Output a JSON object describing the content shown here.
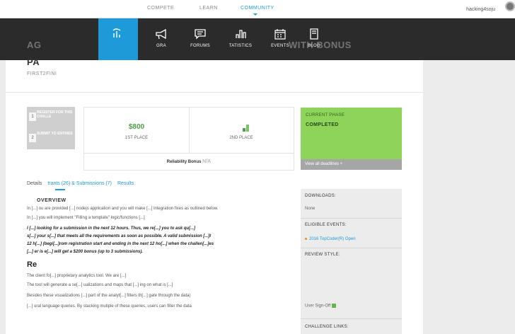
{
  "top_nav": {
    "tabs": [
      "COMPETE",
      "LEARN",
      "COMMUNITY"
    ],
    "active": "COMMUNITY",
    "username": "hacking4soju"
  },
  "sub_nav": {
    "items": [
      "",
      "GRA",
      "FORUMS",
      "TATISTICS",
      "EVENTS",
      "BLOG"
    ]
  },
  "challenge": {
    "title_top": "AG",
    "title_right": "WITH BONUS",
    "title_line2": "PA",
    "track": "FIRST2FINI"
  },
  "steps": [
    {
      "num": "1",
      "text": "REGISTER FOR THIS CHALLE"
    },
    {
      "num": "2",
      "text": "SUBMIT YO ENTRIES"
    }
  ],
  "prizes": {
    "first_amount": "$800",
    "first_label": "1ST PLACE",
    "second_label": "2ND PLACE",
    "reliability_label": "Reliability Bonus",
    "reliability_value": "N/A"
  },
  "phase": {
    "heading": "CURRENT PHASE",
    "value": "COMPLETED",
    "footer": "View all deadlines +"
  },
  "tabs": {
    "details": "Details",
    "registrants": "trants (26) & Submissions (7)",
    "results": "Results"
  },
  "body": {
    "section": "OVERVIEW",
    "p1": "In [...] ou are provided [...] nodejs application and you will make [...] integration fixes as outlined below.",
    "p2": "In [...] you will implement \"Filling a template\" logic/functions [...]",
    "italic1": "I [...] looking for a submission in the next 12 hours. Thus, we re[...] you to ask qu[...]",
    "italic2": "s[...] your s[...] that meets all the requirements as soon as possible. A valid submission [...]t",
    "italic3": "12 h[...] (begi[...]rom registration start and ending in the next 12 ho[...] when the challen[...]es",
    "italic4": "[...] er is e[...] will get a $200 bonus (up to 3 submissions).",
    "h2": "Re",
    "p3": "The client fo[...] proprietary analytics tool. We are [...]",
    "p4": "The tool will generate a se[...] ualizations and maps that [...] ing on what is [...]",
    "p5": "Besides these visualizations [...] part of the analyt[...] filters th[...] gate through the data)",
    "p6": "[...] ural language queries. By stacking mutiple of these queries, users can filter the data"
  },
  "sidebar": {
    "downloads_h": "DOWNLOADS:",
    "downloads_v": "None",
    "events_h": "ELIGIBLE EVENTS:",
    "events_v": "2016 TopCoder(R) Open",
    "review_h": "REVIEW STYLE:",
    "review_v": "User Sign-Off",
    "links_h": "CHALLENGE LINKS:"
  },
  "colors": {
    "accent": "#1c9bd8",
    "phase_green": "#8ed35a",
    "prize_green": "#4ca04a",
    "dark_bar": "#2b2b2b"
  }
}
